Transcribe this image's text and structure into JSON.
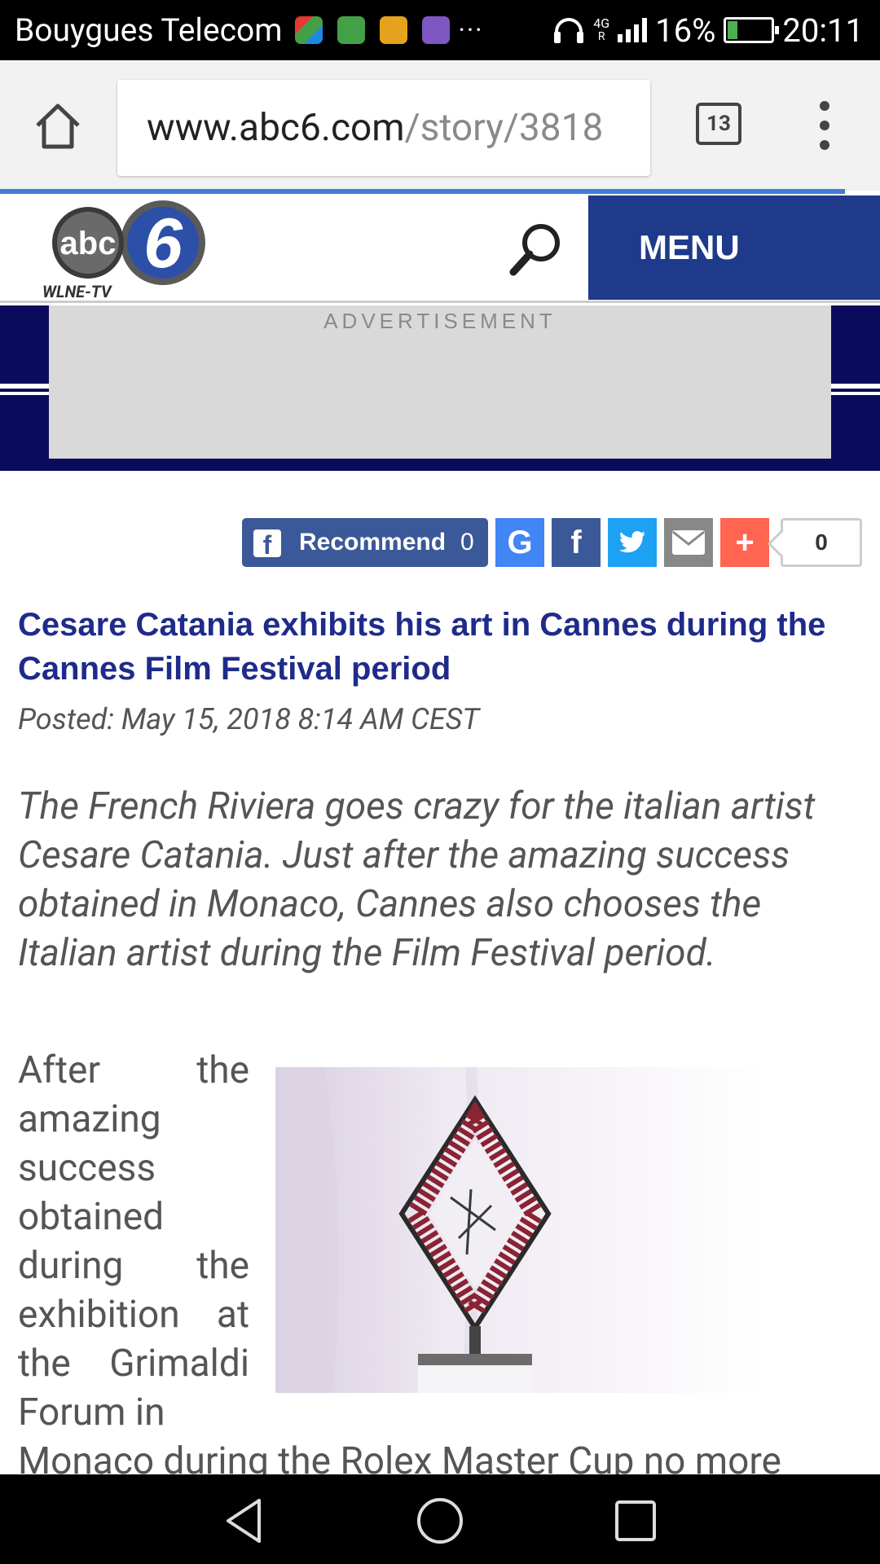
{
  "status_bar": {
    "carrier": "Bouygues Telecom",
    "network_type": "4G",
    "battery_percent": "16%",
    "time": "20:11",
    "notification_icons": [
      "puzzle-app-icon",
      "headset-app-icon",
      "shopping-app-icon",
      "gallery-app-icon"
    ],
    "overflow": "···"
  },
  "browser": {
    "url_host": "www.abc6.com",
    "url_path": "/story/3818",
    "tab_count": "13",
    "load_progress": 0.96
  },
  "site": {
    "logo_sub": "WLNE-TV",
    "menu_label": "MENU",
    "brand_color": "#1f3a8a"
  },
  "ad": {
    "label": "ADVERTISEMENT"
  },
  "share": {
    "recommend_label": "Recommend",
    "recommend_count": "0",
    "total_count": "0",
    "buttons": [
      {
        "name": "google-share",
        "glyph": "G",
        "color": "#4285f4"
      },
      {
        "name": "facebook-share",
        "glyph": "f",
        "color": "#3b5998"
      },
      {
        "name": "twitter-share",
        "glyph": "t",
        "color": "#1da1f2"
      },
      {
        "name": "email-share",
        "glyph": "✉",
        "color": "#888888"
      },
      {
        "name": "more-share",
        "glyph": "+",
        "color": "#ff6550"
      }
    ]
  },
  "article": {
    "headline": "Cesare Catania exhibits his art in Cannes during the Cannes Film Festival period",
    "posted": "Posted: May 15, 2018 8:14 AM CEST",
    "lede": "The French Riviera goes crazy for the italian artist Cesare Catania. Just after the amazing success obtained in Monaco, Cannes also chooses the Italian artist during the Film Festival period.",
    "body_wrapped": "After the amazing success obtained during the exhibition at the Grimaldi Forum in",
    "body_continued": "Monaco during the Rolex Master Cup no more"
  }
}
